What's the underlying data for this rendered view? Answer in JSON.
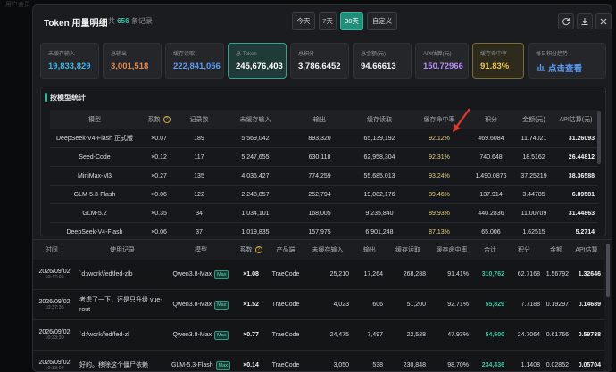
{
  "backdrop": {
    "ghost_text": "用户会员"
  },
  "header": {
    "title": "Token 用量明细",
    "count_prefix": "共",
    "count": "656",
    "count_suffix": "条记录",
    "periods": [
      "今天",
      "7天",
      "30天",
      "自定义"
    ],
    "active_period": "30天",
    "refresh_icon": "refresh-icon",
    "download_icon": "download-icon",
    "close_icon": "close-icon"
  },
  "cards": [
    {
      "label": "未缓存输入",
      "value": "19,833,829",
      "color": "#3db4e6"
    },
    {
      "label": "总输出",
      "value": "3,001,518",
      "color": "#e8894a"
    },
    {
      "label": "缓存读取",
      "value": "222,841,056",
      "color": "#5a9bf5"
    },
    {
      "label": "总 Token",
      "value": "245,676,403",
      "color": "#ffffff"
    },
    {
      "label": "总积分",
      "value": "3,786.6452",
      "color": "#f0f1f3"
    },
    {
      "label": "总金额(元)",
      "value": "94.66613",
      "color": "#f0f1f3"
    },
    {
      "label": "API估算(元)",
      "value": "150.72966",
      "color": "#b58cf5"
    },
    {
      "label": "缓存命中率",
      "value": "91.83%",
      "color": "#e8c94a"
    },
    {
      "label": "每日积分趋势",
      "value": "点击查看",
      "color": "#5a9bf5"
    }
  ],
  "model_stats": {
    "title": "按模型统计",
    "headers": [
      "模型",
      "系数",
      "记录数",
      "未缓存输入",
      "输出",
      "缓存读取",
      "缓存命中率",
      "积分",
      "金额(元)",
      "API估算(元)"
    ],
    "rows": [
      [
        "DeepSeek-V4-Flash 正式版",
        "×0.07",
        "189",
        "5,569,042",
        "893,320",
        "65,139,192",
        "92.12%",
        "469.6084",
        "11.74021",
        "31.26093"
      ],
      [
        "Seed-Code",
        "×0.12",
        "117",
        "5,247,655",
        "630,118",
        "62,958,304",
        "92.31%",
        "740.648",
        "18.5162",
        "26.44812"
      ],
      [
        "MiniMax-M3",
        "×0.27",
        "135",
        "4,035,427",
        "774,259",
        "55,685,013",
        "93.24%",
        "1,490.0876",
        "37.25219",
        "38.36588"
      ],
      [
        "GLM-5.3-Flash",
        "×0.06",
        "122",
        "2,248,857",
        "252,794",
        "19,082,176",
        "89.46%",
        "137.914",
        "3.44785",
        "6.89581"
      ],
      [
        "GLM-5.2",
        "×0.35",
        "34",
        "1,034,101",
        "168,005",
        "9,235,840",
        "89.93%",
        "440.2836",
        "11.00709",
        "31.44863"
      ],
      [
        "DeepSeek-V4-Flash",
        "×0.06",
        "37",
        "1,019,835",
        "157,975",
        "6,901,248",
        "87.13%",
        "65.006",
        "1.62515",
        "5.2714"
      ]
    ]
  },
  "usage": {
    "headers": [
      "时间",
      "使用记录",
      "模型",
      "系数",
      "产品端",
      "未缓存输入",
      "输出",
      "缓存读取",
      "缓存命中率",
      "合计",
      "积分",
      "金额",
      "API估算"
    ],
    "badge": "Max",
    "rows": [
      {
        "date": "2026/09/02",
        "time": "10:47:05",
        "record": "`d:\\work\\fed\\fed-zlb",
        "model": "Qwen3.8-Max",
        "coef": "×1.08",
        "client": "TraeCode",
        "uncached": "25,210",
        "output": "17,264",
        "cache_read": "268,288",
        "hit": "91.41%",
        "total": "310,762",
        "points": "62.7168",
        "amount": "1.56792",
        "api": "1.32646"
      },
      {
        "date": "2026/09/02",
        "time": "10:37:36",
        "record": "考虑了一下，还是只升级 vue-rout",
        "model": "Qwen3.8-Max",
        "coef": "×1.52",
        "client": "TraeCode",
        "uncached": "4,023",
        "output": "606",
        "cache_read": "51,200",
        "hit": "92.71%",
        "total": "55,829",
        "points": "7.7188",
        "amount": "0.19297",
        "api": "0.14689"
      },
      {
        "date": "2026/09/02",
        "time": "10:33:30",
        "record": "`d:/work/fed/fed-zl",
        "model": "Qwen3.8-Max",
        "coef": "×0.77",
        "client": "TraeCode",
        "uncached": "24,475",
        "output": "7,497",
        "cache_read": "22,528",
        "hit": "47.93%",
        "total": "54,500",
        "points": "24.7064",
        "amount": "0.61766",
        "api": "0.59738"
      },
      {
        "date": "2026/09/02",
        "time": "10:13:02",
        "record": "好的。移除这个僵尸依赖",
        "model": "GLM-5.3-Flash",
        "coef": "×0.14",
        "client": "TraeCode",
        "uncached": "3,050",
        "output": "538",
        "cache_read": "230,848",
        "hit": "98.70%",
        "total": "234,436",
        "points": "1.1408",
        "amount": "0.02852",
        "api": "0.05704"
      }
    ]
  }
}
